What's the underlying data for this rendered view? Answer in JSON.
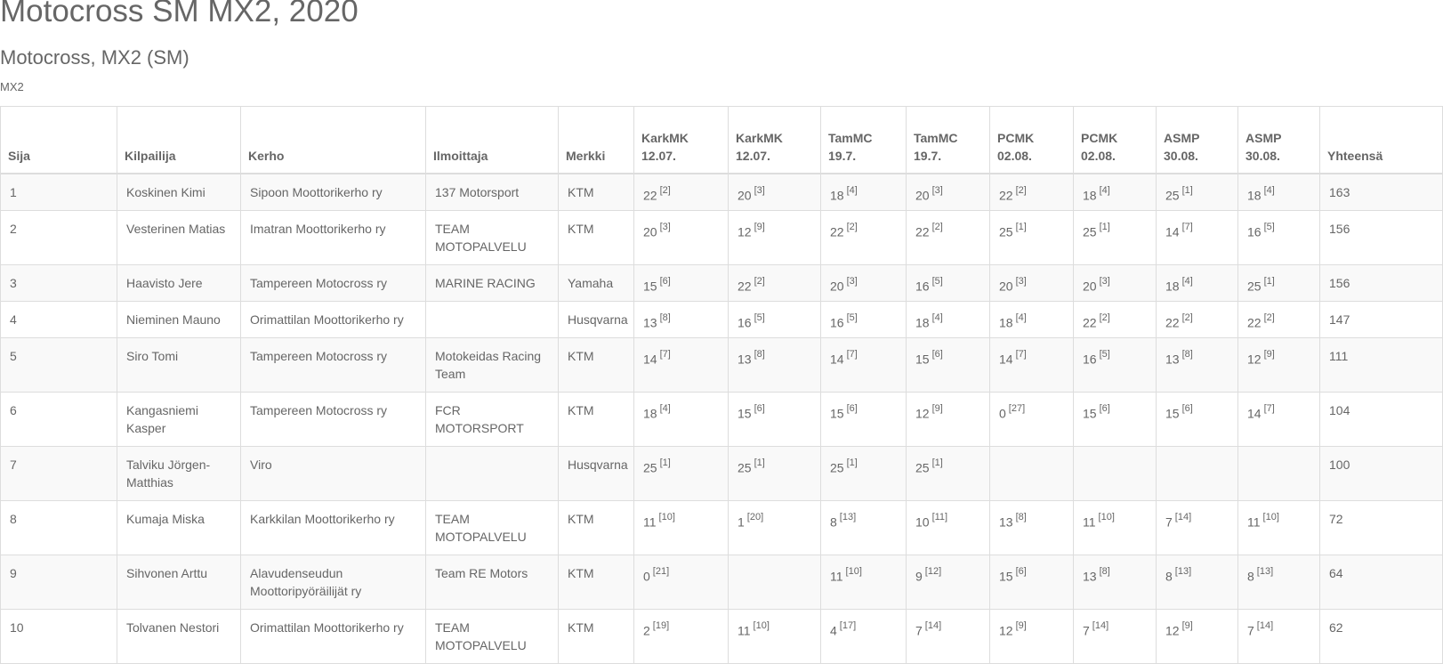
{
  "page": {
    "title": "Motocross SM MX2, 2020",
    "subtitle": "Motocross, MX2 (SM)",
    "class_label": "MX2"
  },
  "table": {
    "headers": {
      "sija": "Sija",
      "kilpailija": "Kilpailija",
      "kerho": "Kerho",
      "ilmoittaja": "Ilmoittaja",
      "merkki": "Merkki",
      "yhteensa": "Yhteensä"
    },
    "races": [
      {
        "name": "KarkMK",
        "date": "12.07."
      },
      {
        "name": "KarkMK",
        "date": "12.07."
      },
      {
        "name": "TamMC",
        "date": "19.7."
      },
      {
        "name": "TamMC",
        "date": "19.7."
      },
      {
        "name": "PCMK",
        "date": "02.08."
      },
      {
        "name": "PCMK",
        "date": "02.08."
      },
      {
        "name": "ASMP",
        "date": "30.08."
      },
      {
        "name": "ASMP",
        "date": "30.08."
      }
    ],
    "rows": [
      {
        "sija": "1",
        "kilpailija": "Koskinen Kimi",
        "kerho": "Sipoon Moottorikerho ry",
        "ilmoittaja": "137 Motorsport",
        "merkki": "KTM",
        "results": [
          {
            "p": "22",
            "r": "[2]"
          },
          {
            "p": "20",
            "r": "[3]"
          },
          {
            "p": "18",
            "r": "[4]"
          },
          {
            "p": "20",
            "r": "[3]"
          },
          {
            "p": "22",
            "r": "[2]"
          },
          {
            "p": "18",
            "r": "[4]"
          },
          {
            "p": "25",
            "r": "[1]"
          },
          {
            "p": "18",
            "r": "[4]"
          }
        ],
        "total": "163"
      },
      {
        "sija": "2",
        "kilpailija": "Vesterinen Matias",
        "kerho": "Imatran Moottorikerho ry",
        "ilmoittaja": "TEAM MOTOPALVELU",
        "merkki": "KTM",
        "results": [
          {
            "p": "20",
            "r": "[3]"
          },
          {
            "p": "12",
            "r": "[9]"
          },
          {
            "p": "22",
            "r": "[2]"
          },
          {
            "p": "22",
            "r": "[2]"
          },
          {
            "p": "25",
            "r": "[1]"
          },
          {
            "p": "25",
            "r": "[1]"
          },
          {
            "p": "14",
            "r": "[7]"
          },
          {
            "p": "16",
            "r": "[5]"
          }
        ],
        "total": "156"
      },
      {
        "sija": "3",
        "kilpailija": "Haavisto Jere",
        "kerho": "Tampereen Motocross ry",
        "ilmoittaja": "MARINE RACING",
        "merkki": "Yamaha",
        "results": [
          {
            "p": "15",
            "r": "[6]"
          },
          {
            "p": "22",
            "r": "[2]"
          },
          {
            "p": "20",
            "r": "[3]"
          },
          {
            "p": "16",
            "r": "[5]"
          },
          {
            "p": "20",
            "r": "[3]"
          },
          {
            "p": "20",
            "r": "[3]"
          },
          {
            "p": "18",
            "r": "[4]"
          },
          {
            "p": "25",
            "r": "[1]"
          }
        ],
        "total": "156"
      },
      {
        "sija": "4",
        "kilpailija": "Nieminen Mauno",
        "kerho": "Orimattilan Moottorikerho ry",
        "ilmoittaja": "",
        "merkki": "Husqvarna",
        "results": [
          {
            "p": "13",
            "r": "[8]"
          },
          {
            "p": "16",
            "r": "[5]"
          },
          {
            "p": "16",
            "r": "[5]"
          },
          {
            "p": "18",
            "r": "[4]"
          },
          {
            "p": "18",
            "r": "[4]"
          },
          {
            "p": "22",
            "r": "[2]"
          },
          {
            "p": "22",
            "r": "[2]"
          },
          {
            "p": "22",
            "r": "[2]"
          }
        ],
        "total": "147"
      },
      {
        "sija": "5",
        "kilpailija": "Siro Tomi",
        "kerho": "Tampereen Motocross ry",
        "ilmoittaja": "Motokeidas Racing Team",
        "merkki": "KTM",
        "results": [
          {
            "p": "14",
            "r": "[7]"
          },
          {
            "p": "13",
            "r": "[8]"
          },
          {
            "p": "14",
            "r": "[7]"
          },
          {
            "p": "15",
            "r": "[6]"
          },
          {
            "p": "14",
            "r": "[7]"
          },
          {
            "p": "16",
            "r": "[5]"
          },
          {
            "p": "13",
            "r": "[8]"
          },
          {
            "p": "12",
            "r": "[9]"
          }
        ],
        "total": "111"
      },
      {
        "sija": "6",
        "kilpailija": "Kangasniemi Kasper",
        "kerho": "Tampereen Motocross ry",
        "ilmoittaja": "FCR MOTORSPORT",
        "merkki": "KTM",
        "results": [
          {
            "p": "18",
            "r": "[4]"
          },
          {
            "p": "15",
            "r": "[6]"
          },
          {
            "p": "15",
            "r": "[6]"
          },
          {
            "p": "12",
            "r": "[9]"
          },
          {
            "p": "0",
            "r": "[27]"
          },
          {
            "p": "15",
            "r": "[6]"
          },
          {
            "p": "15",
            "r": "[6]"
          },
          {
            "p": "14",
            "r": "[7]"
          }
        ],
        "total": "104"
      },
      {
        "sija": "7",
        "kilpailija": "Talviku Jörgen-Matthias",
        "kerho": "Viro",
        "ilmoittaja": "",
        "merkki": "Husqvarna",
        "results": [
          {
            "p": "25",
            "r": "[1]"
          },
          {
            "p": "25",
            "r": "[1]"
          },
          {
            "p": "25",
            "r": "[1]"
          },
          {
            "p": "25",
            "r": "[1]"
          },
          {
            "p": "",
            "r": ""
          },
          {
            "p": "",
            "r": ""
          },
          {
            "p": "",
            "r": ""
          },
          {
            "p": "",
            "r": ""
          }
        ],
        "total": "100"
      },
      {
        "sija": "8",
        "kilpailija": "Kumaja Miska",
        "kerho": "Karkkilan Moottorikerho ry",
        "ilmoittaja": "TEAM MOTOPALVELU",
        "merkki": "KTM",
        "results": [
          {
            "p": "11",
            "r": "[10]"
          },
          {
            "p": "1",
            "r": "[20]"
          },
          {
            "p": "8",
            "r": "[13]"
          },
          {
            "p": "10",
            "r": "[11]"
          },
          {
            "p": "13",
            "r": "[8]"
          },
          {
            "p": "11",
            "r": "[10]"
          },
          {
            "p": "7",
            "r": "[14]"
          },
          {
            "p": "11",
            "r": "[10]"
          }
        ],
        "total": "72"
      },
      {
        "sija": "9",
        "kilpailija": "Sihvonen Arttu",
        "kerho": "Alavudenseudun Moottoripyöräilijät ry",
        "ilmoittaja": "Team RE Motors",
        "merkki": "KTM",
        "results": [
          {
            "p": "0",
            "r": "[21]"
          },
          {
            "p": "",
            "r": ""
          },
          {
            "p": "11",
            "r": "[10]"
          },
          {
            "p": "9",
            "r": "[12]"
          },
          {
            "p": "15",
            "r": "[6]"
          },
          {
            "p": "13",
            "r": "[8]"
          },
          {
            "p": "8",
            "r": "[13]"
          },
          {
            "p": "8",
            "r": "[13]"
          }
        ],
        "total": "64"
      },
      {
        "sija": "10",
        "kilpailija": "Tolvanen Nestori",
        "kerho": "Orimattilan Moottorikerho ry",
        "ilmoittaja": "TEAM MOTOPALVELU",
        "merkki": "KTM",
        "results": [
          {
            "p": "2",
            "r": "[19]"
          },
          {
            "p": "11",
            "r": "[10]"
          },
          {
            "p": "4",
            "r": "[17]"
          },
          {
            "p": "7",
            "r": "[14]"
          },
          {
            "p": "12",
            "r": "[9]"
          },
          {
            "p": "7",
            "r": "[14]"
          },
          {
            "p": "12",
            "r": "[9]"
          },
          {
            "p": "7",
            "r": "[14]"
          }
        ],
        "total": "62"
      }
    ]
  }
}
